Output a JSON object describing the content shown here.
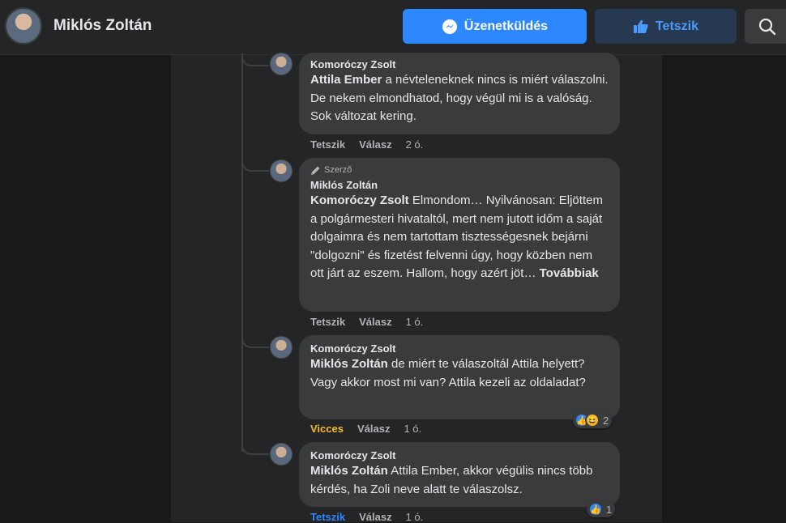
{
  "header": {
    "page_name": "Miklós Zoltán",
    "message_button": "Üzenetküldés",
    "like_button": "Tetszik"
  },
  "comments": [
    {
      "author": "Komoróczy Zsolt",
      "mention": "Attila Ember",
      "text": " a névteleneknek nincs is miért válaszolni. De nekem elmondhatod, hogy végül mi is a valóság. Sok változat kering.",
      "actions": {
        "like": "Tetszik",
        "reply": "Válasz",
        "time": "2 ó."
      }
    },
    {
      "badge": "Szerző",
      "author": "Miklós Zoltán",
      "mention": "Komoróczy Zsolt",
      "text": " Elmondom… Nyilvánosan: Eljöttem a polgármesteri hivataltól, mert nem jutott időm a saját dolgaimra és nem tartottam tisztességesnek bejárni \"dolgozni\" és fizetést felvenni úgy, hogy közben nem ott járt az eszem. Hallom, hogy azért jöt… ",
      "more": "Továbbiak",
      "actions": {
        "like": "Tetszik",
        "reply": "Válasz",
        "time": "1 ó."
      }
    },
    {
      "author": "Komoróczy Zsolt",
      "mention": "Miklós Zoltán",
      "text": " de miért te válaszoltál Attila helyett? Vagy akkor most mi van? Attila kezeli az oldaladat?",
      "actions": {
        "like": "Vicces",
        "reply": "Válasz",
        "time": "1 ó."
      },
      "reaction_count": "2"
    },
    {
      "author": "Komoróczy Zsolt",
      "mention": "Miklós Zoltán",
      "text": " Attila Ember, akkor végülis nincs több kérdés, ha Zoli neve alatt te válaszolsz.",
      "actions": {
        "like": "Tetszik",
        "reply": "Válasz",
        "time": "1 ó."
      },
      "reaction_count": "1"
    }
  ],
  "colors": {
    "accent": "#2d88ff",
    "funny": "#f7b928",
    "bubble": "#3a3b3c"
  }
}
